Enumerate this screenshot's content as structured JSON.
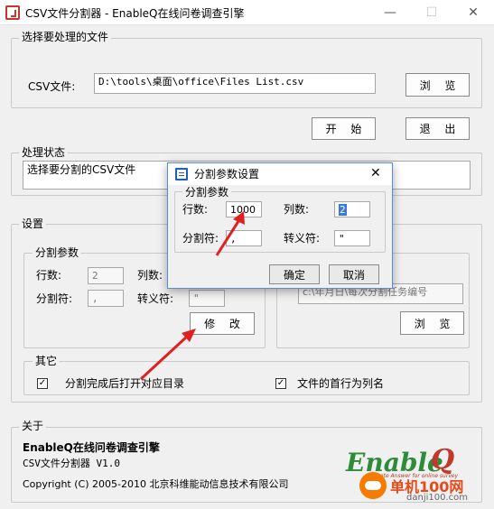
{
  "window": {
    "title": "CSV文件分割器 - EnableQ在线问卷调查引擎",
    "minimize_glyph": "—",
    "maximize_glyph": "☐",
    "close_glyph": "✕"
  },
  "select_file": {
    "group_label": "选择要处理的文件",
    "csv_label": "CSV文件:",
    "csv_value": "D:\\tools\\桌面\\office\\Files List.csv",
    "browse_button": "浏 览"
  },
  "actions": {
    "start_button": "开 始",
    "exit_button": "退 出"
  },
  "status": {
    "group_label": "处理状态",
    "text": "选择要分割的CSV文件"
  },
  "settings": {
    "group_label": "设置",
    "split_params": {
      "group_label": "分割参数",
      "rows_label": "行数:",
      "rows_value": "2",
      "cols_label": "列数:",
      "cols_value": "",
      "sep_label": "分割符:",
      "sep_value": ",",
      "escape_label": "转义符:",
      "escape_value": "\"",
      "modify_button": "修 改"
    },
    "output": {
      "path_value": "c:\\年月日\\每次分割任务编号",
      "browse_button": "浏 览"
    },
    "other": {
      "group_label": "其它",
      "open_dir_label": "分割完成后打开对应目录",
      "open_dir_checked": true,
      "first_row_label": "文件的首行为列名",
      "first_row_checked": true
    }
  },
  "about": {
    "group_label": "关于",
    "product": "EnableQ在线问卷调查引擎",
    "version": "CSV文件分割器  V1.0",
    "copyright": "Copyright (C) 2005-2010 北京科维能动信息技术有限公司",
    "logo_text": "Enable",
    "logo_q": "Q",
    "logo_tagline": "Ultimate Answer for online survey"
  },
  "dialog": {
    "title": "分割参数设置",
    "group_label": "分割参数",
    "rows_label": "行数:",
    "rows_value": "1000",
    "cols_label": "列数:",
    "cols_value": "2",
    "sep_label": "分割符:",
    "sep_value": ",",
    "escape_label": "转义符:",
    "escape_value": "\"",
    "ok_button": "确定",
    "cancel_button": "取消",
    "close_glyph": "✕"
  },
  "watermark": {
    "site_name": "单机100网",
    "site_url": "danji100.com"
  },
  "colors": {
    "arrow": "#e02020",
    "accent": "#1c61b8",
    "logo_red": "#c0392b",
    "logo_green": "#2e8b3a"
  }
}
